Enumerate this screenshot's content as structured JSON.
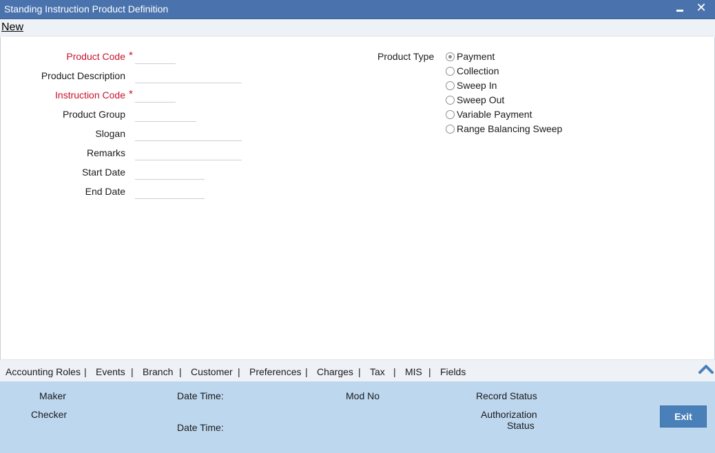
{
  "window": {
    "title": "Standing Instruction Product Definition",
    "minimize_label": "",
    "close_label": "✕"
  },
  "menu": {
    "new_label": "New"
  },
  "form": {
    "product_code": {
      "label": "Product Code",
      "required_mark": "*",
      "value": ""
    },
    "product_description": {
      "label": "Product Description",
      "value": ""
    },
    "instruction_code": {
      "label": "Instruction Code",
      "required_mark": "*",
      "value": ""
    },
    "product_group": {
      "label": "Product Group",
      "value": ""
    },
    "slogan": {
      "label": "Slogan",
      "value": ""
    },
    "remarks": {
      "label": "Remarks",
      "value": ""
    },
    "start_date": {
      "label": "Start Date",
      "value": ""
    },
    "end_date": {
      "label": "End Date",
      "value": ""
    }
  },
  "product_type": {
    "label": "Product Type",
    "selected": "Payment",
    "options": [
      "Payment",
      "Collection",
      "Sweep In",
      "Sweep Out",
      "Variable Payment",
      "Range Balancing Sweep"
    ]
  },
  "tabs": [
    "Accounting Roles",
    "Events",
    "Branch",
    "Customer",
    "Preferences",
    "Charges",
    "Tax",
    "MIS",
    "Fields"
  ],
  "tab_separator": "|",
  "footer": {
    "maker": "Maker",
    "checker": "Checker",
    "date_time_1": "Date Time:",
    "date_time_2": "Date Time:",
    "mod_no": "Mod No",
    "record_status": "Record Status",
    "authorization": "Authorization",
    "status": "Status",
    "exit_label": "Exit"
  },
  "colors": {
    "titlebar": "#4a73ad",
    "required": "#c8102e",
    "footer": "#bdd7ee",
    "exit_button": "#4a80b9"
  },
  "icons": {
    "collapse": "chevron-up-icon",
    "close": "close-icon",
    "minimize": "minimize-icon"
  }
}
